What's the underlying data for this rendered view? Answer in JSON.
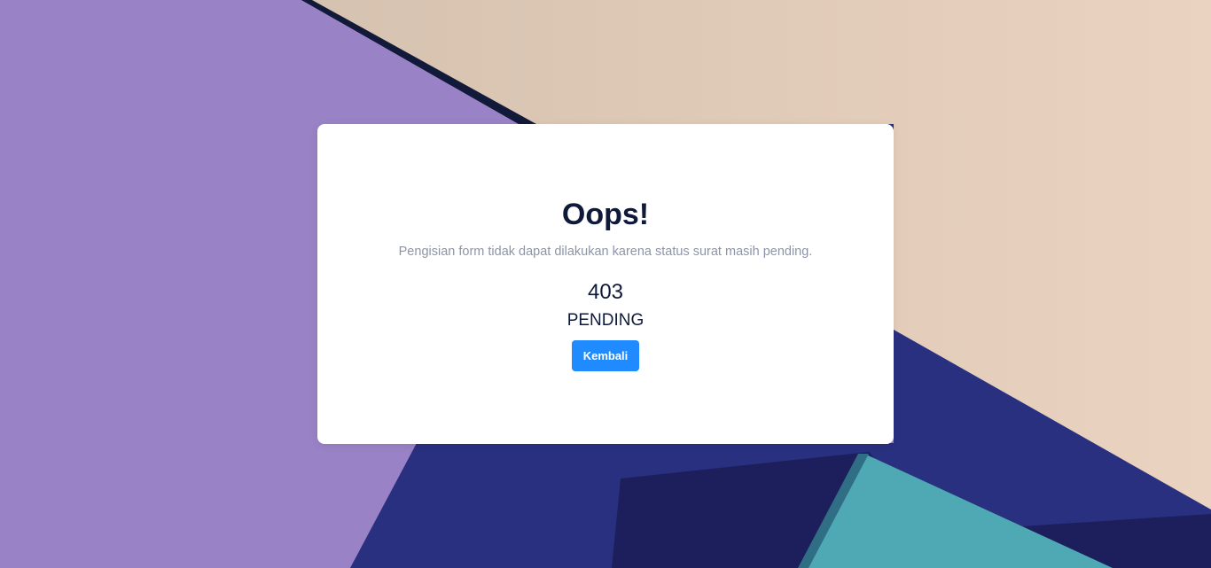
{
  "error": {
    "title": "Oops!",
    "message": "Pengisian form tidak dapat dilakukan karena status surat masih pending.",
    "code": "403",
    "status": "PENDING",
    "back_button_label": "Kembali"
  },
  "colors": {
    "purple_panel": "#9a82c6",
    "beige_panel": "#dcc8b5",
    "navy": "#2a3080",
    "dark_navy": "#1c1f5c",
    "teal": "#4fa9b4",
    "button": "#1f8bff",
    "heading_text": "#0f1a3a",
    "message_text": "#8c95a8"
  }
}
